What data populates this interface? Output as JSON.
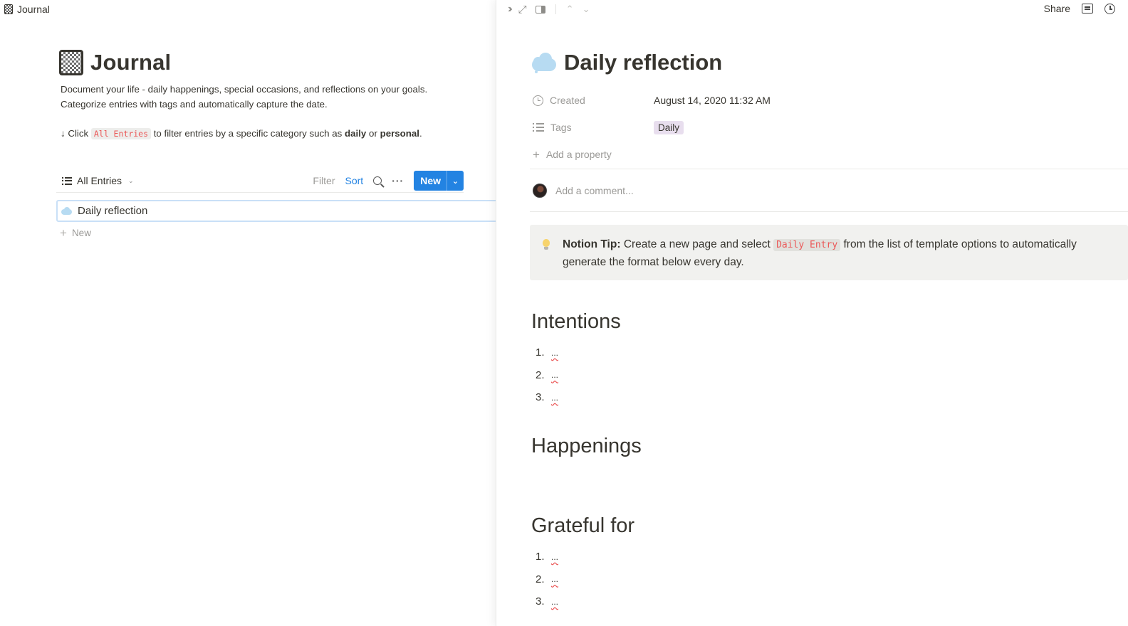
{
  "left": {
    "breadcrumb": "Journal",
    "title": "Journal",
    "desc_line1": "Document your life - daily happenings, special occasions, and reflections on your goals.",
    "desc_line2": "Categorize entries with tags and automatically capture the date.",
    "hint_prefix": "↓ Click",
    "hint_code": "All Entries",
    "hint_mid": "to filter entries by a specific category such as",
    "hint_bold1": "daily",
    "hint_or": "or",
    "hint_bold2": "personal",
    "hint_end": ".",
    "view_name": "All Entries",
    "filter_label": "Filter",
    "sort_label": "Sort",
    "more_label": "···",
    "new_button": "New",
    "rows": [
      {
        "title": "Daily reflection"
      }
    ],
    "new_row_label": "New"
  },
  "right": {
    "share_label": "Share",
    "title": "Daily reflection",
    "properties": {
      "created_label": "Created",
      "created_value": "August 14, 2020 11:32 AM",
      "tags_label": "Tags",
      "tags_value": "Daily",
      "add_property": "Add a property"
    },
    "comment_placeholder": "Add a comment...",
    "callout": {
      "bold": "Notion Tip:",
      "text1": "Create a new page and select",
      "code": "Daily Entry",
      "text2": "from the list of template options to automatically generate the format below every day."
    },
    "sections": [
      {
        "heading": "Intentions",
        "items": [
          "...",
          "...",
          "..."
        ]
      },
      {
        "heading": "Happenings",
        "items": []
      },
      {
        "heading": "Grateful for",
        "items": [
          "...",
          "...",
          "..."
        ]
      }
    ]
  },
  "colors": {
    "accent_blue": "#2383e2",
    "code_red": "#eb5757",
    "tag_purple_bg": "#e8deee",
    "callout_bg": "#f1f1ef"
  },
  "icons": {
    "journal": "checkered-notebook-icon",
    "page": "cloud-icon",
    "callout": "lightbulb-icon"
  }
}
